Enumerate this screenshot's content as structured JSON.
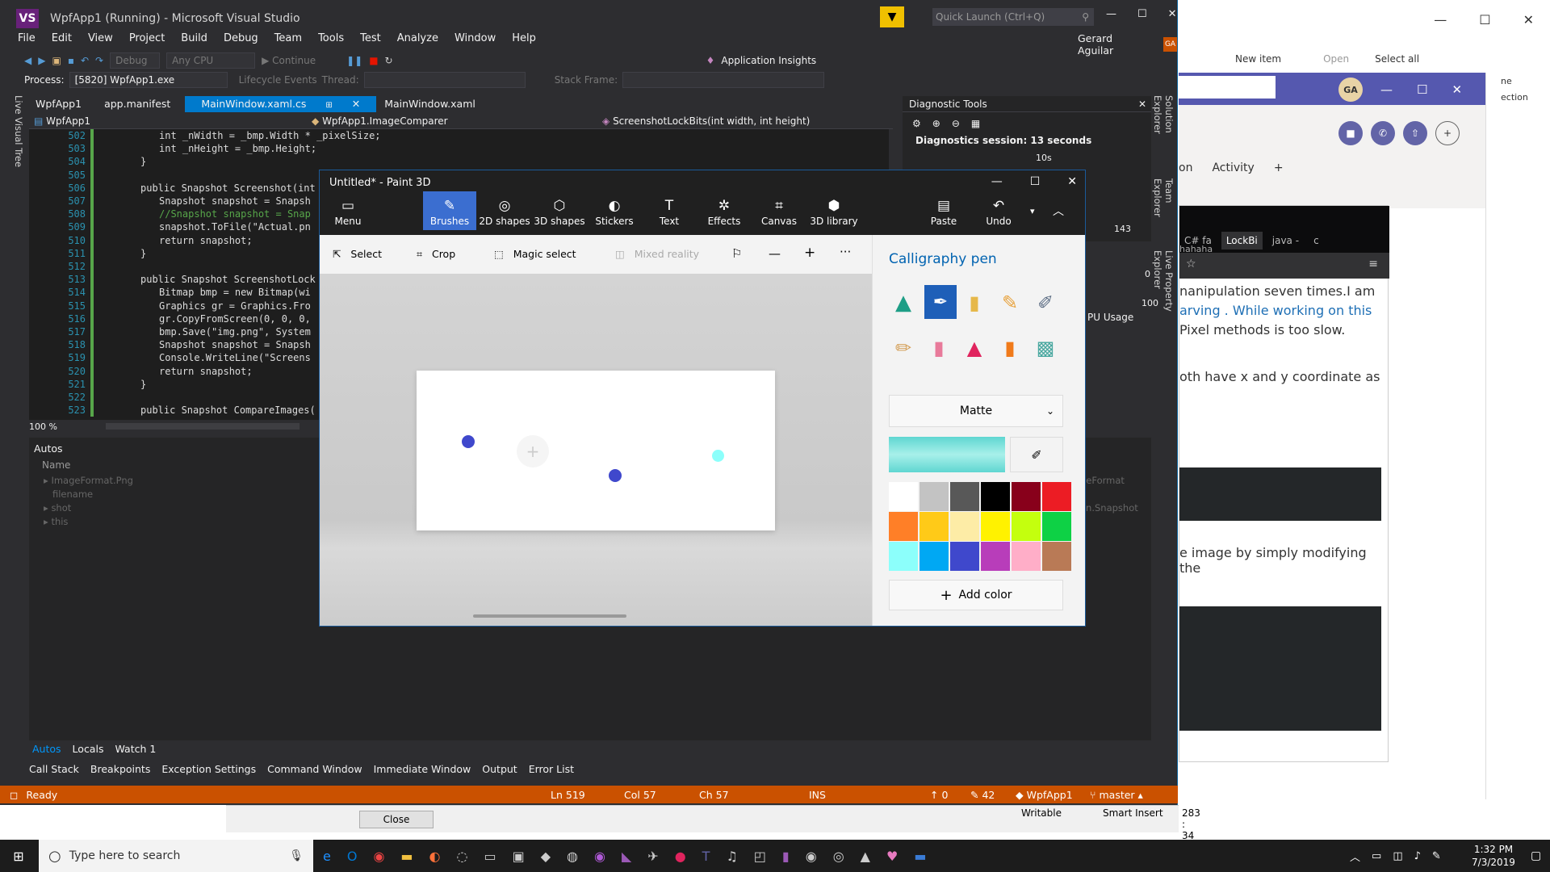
{
  "vs": {
    "title": "WpfApp1 (Running) - Microsoft Visual Studio",
    "quick_launch_placeholder": "Quick Launch (Ctrl+Q)",
    "user": "Gerard Aguilar",
    "user_initials": "GA",
    "menu": [
      "File",
      "Edit",
      "View",
      "Project",
      "Build",
      "Debug",
      "Team",
      "Tools",
      "Test",
      "Analyze",
      "Window",
      "Help"
    ],
    "toolbar": {
      "config": "Debug",
      "platform": "Any CPU",
      "continue": "Continue",
      "insights": "Application Insights"
    },
    "process_label": "Process:",
    "process_value": "[5820] WpfApp1.exe",
    "lifecycle": "Lifecycle Events",
    "thread_label": "Thread:",
    "stack_frame_label": "Stack Frame:",
    "tabs": [
      "WpfApp1",
      "app.manifest",
      "MainWindow.xaml.cs",
      "MainWindow.xaml"
    ],
    "nav": {
      "project": "WpfApp1",
      "class": "WpfApp1.ImageComparer",
      "member": "ScreenshotLockBits(int width, int height)"
    },
    "line_numbers": [
      "502",
      "503",
      "504",
      "505",
      "506",
      "507",
      "508",
      "509",
      "510",
      "511",
      "512",
      "513",
      "514",
      "515",
      "516",
      "517",
      "518",
      "519",
      "520",
      "521",
      "522",
      "523"
    ],
    "code": [
      "int _nWidth = _bmp.Width * _pixelSize;",
      "int _nHeight = _bmp.Height;",
      "}",
      "",
      "public Snapshot Screenshot(int",
      "Snapshot snapshot = Snapsh",
      "//Snapshot snapshot = Snap",
      "snapshot.ToFile(\"Actual.pn",
      "return snapshot;",
      "}",
      "",
      "public Snapshot ScreenshotLock",
      "Bitmap bmp = new Bitmap(wi",
      "Graphics gr = Graphics.Fro",
      "gr.CopyFromScreen(0, 0, 0,",
      "bmp.Save(\"img.png\", System",
      "Snapshot snapshot = Snapsh",
      "Console.WriteLine(\"Screens",
      "return snapshot;",
      "}",
      "",
      "public Snapshot CompareImages("
    ],
    "zoom": "100 %",
    "autos_title": "Autos",
    "autos_col": "Name",
    "autos_rows": [
      "ImageFormat.Png",
      "filename",
      "shot",
      "this"
    ],
    "autos_values": [
      "geFormat",
      "on.Snapshot"
    ],
    "bottom_tabs": [
      "Autos",
      "Locals",
      "Watch 1"
    ],
    "tool_tabs": [
      "Call Stack",
      "Breakpoints",
      "Exception Settings",
      "Command Window",
      "Immediate Window",
      "Output",
      "Error List"
    ],
    "status": {
      "ready": "Ready",
      "ln": "Ln 519",
      "col": "Col 57",
      "ch": "Ch 57",
      "ins": "INS",
      "up": "0",
      "edits": "42",
      "repo": "WpfApp1",
      "branch": "master"
    },
    "diag_title": "Diagnostic Tools",
    "diag_session": "Diagnostics session: 13 seconds",
    "diag_time": "10s",
    "diag_vals": [
      "143",
      "0",
      "100"
    ],
    "cpu_usage": "PU Usage",
    "side_tabs": [
      "Solution Explorer",
      "Team Explorer",
      "Live Property Explorer"
    ],
    "left_tab": "Live Visual Tree",
    "close_btn": "Close",
    "under_status": {
      "writable": "Writable",
      "smart": "Smart Insert",
      "pos": "283 : 34"
    }
  },
  "paint": {
    "title": "Untitled* - Paint 3D",
    "tools": [
      "Menu",
      "Brushes",
      "2D shapes",
      "3D shapes",
      "Stickers",
      "Text",
      "Effects",
      "Canvas",
      "3D library"
    ],
    "actions": [
      "Paste",
      "Undo"
    ],
    "sub": [
      "Select",
      "Crop",
      "Magic select",
      "Mixed reality"
    ],
    "panel_title": "Calligraphy pen",
    "finish": "Matte",
    "add_color": "Add color",
    "swatches": [
      "#ffffff",
      "#c3c3c3",
      "#585858",
      "#000000",
      "#88001b",
      "#ec1c24",
      "#ff7f27",
      "#ffca18",
      "#fdeca6",
      "#fff200",
      "#c4ff0e",
      "#0ed145",
      "#8cfffb",
      "#00a8f3",
      "#3f48cc",
      "#b83dba",
      "#ffaec8",
      "#b97a56"
    ],
    "accent": "#0078d7"
  },
  "right": {
    "teams_tabs": [
      "on",
      "Activity"
    ],
    "browser_tabs": [
      "C# fa",
      "LockBi",
      "java -",
      "c"
    ],
    "text_lines": [
      "hahaha",
      "nanipulation  seven  times.I  am",
      "arving . While working on this",
      "Pixel methods is too slow.",
      "oth  have x and y coordinate as",
      "e image by simply modifying the"
    ],
    "toolbar": [
      "New item",
      "Open",
      "Select all"
    ],
    "snippet": [
      "ne",
      "ection"
    ]
  },
  "taskbar": {
    "search_placeholder": "Type here to search",
    "time": "1:32 PM",
    "date": "7/3/2019"
  }
}
